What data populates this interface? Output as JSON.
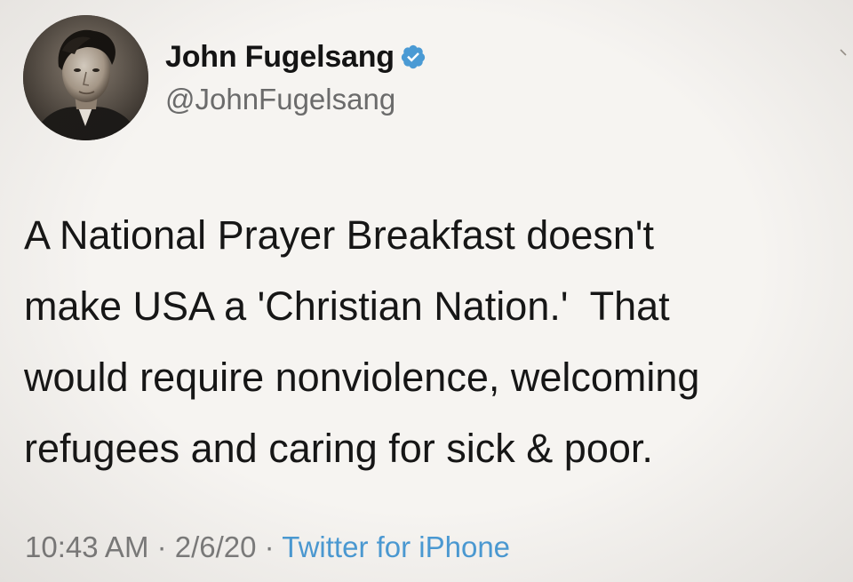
{
  "tweet": {
    "display_name": "John Fugelsang",
    "handle": "@JohnFugelsang",
    "verified": true,
    "body_lines": [
      "A National Prayer Breakfast doesn't",
      "make USA a 'Christian Nation.'  That",
      "would require nonviolence, welcoming",
      "refugees and caring for sick & poor."
    ],
    "time": "10:43 AM",
    "separator": " · ",
    "date": "2/6/20",
    "source": "Twitter for iPhone"
  },
  "colors": {
    "background": "#f6f4f1",
    "verified_badge": "#4a9ad4",
    "source_link": "#4a9ad4",
    "meta_text": "#7c7c7c",
    "handle_text": "#6b6b6b"
  },
  "icons": {
    "verified": "verified-badge-icon",
    "avatar": "profile-photo"
  }
}
